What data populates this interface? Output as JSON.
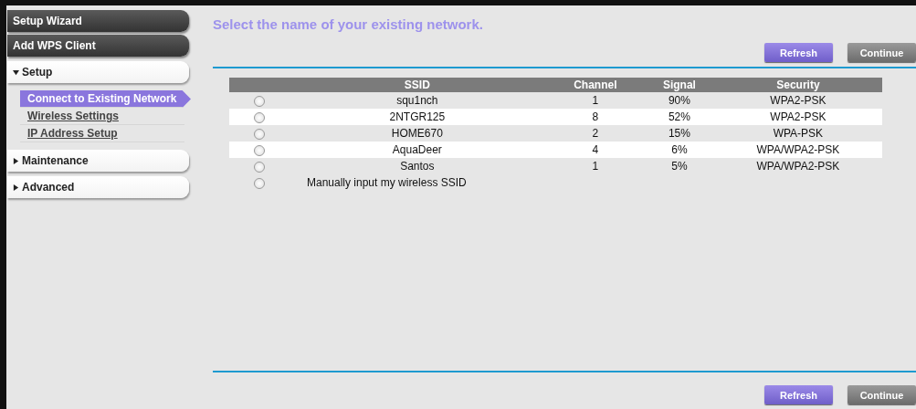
{
  "sidebar": {
    "items": [
      {
        "kind": "button",
        "label": "Setup Wizard"
      },
      {
        "kind": "button",
        "label": "Add WPS Client"
      },
      {
        "kind": "section",
        "label": "Setup",
        "expanded": true,
        "children": [
          {
            "label": "Connect to Existing Network",
            "selected": true
          },
          {
            "label": "Wireless Settings",
            "selected": false
          },
          {
            "label": "IP Address Setup",
            "selected": false
          }
        ]
      },
      {
        "kind": "section",
        "label": "Maintenance",
        "expanded": false
      },
      {
        "kind": "section",
        "label": "Advanced",
        "expanded": false
      }
    ]
  },
  "title": "Select the name of your existing network.",
  "top_buttons": [
    {
      "label": "Refresh",
      "kind": "primary"
    },
    {
      "label": "Continue",
      "kind": "secondary"
    }
  ],
  "table": {
    "columns": [
      "SSID",
      "Channel",
      "Signal",
      "Security"
    ],
    "rows": [
      {
        "selected": false,
        "ssid": "squ1nch",
        "channel": "1",
        "signal": "90%",
        "security": "WPA2-PSK"
      },
      {
        "selected": false,
        "ssid": "2NTGR125",
        "channel": "8",
        "signal": "52%",
        "security": "WPA2-PSK"
      },
      {
        "selected": false,
        "ssid": "HOME670",
        "channel": "2",
        "signal": "15%",
        "security": "WPA-PSK"
      },
      {
        "selected": false,
        "ssid": "AquaDeer",
        "channel": "4",
        "signal": "6%",
        "security": "WPA/WPA2-PSK"
      },
      {
        "selected": false,
        "ssid": "Santos",
        "channel": "1",
        "signal": "5%",
        "security": "WPA/WPA2-PSK"
      }
    ],
    "manual": {
      "label": "Manually input my wireless SSID",
      "selected": false
    }
  },
  "bottom_buttons": [
    {
      "label": "Refresh",
      "kind": "primary"
    },
    {
      "label": "Continue",
      "kind": "secondary"
    }
  ]
}
